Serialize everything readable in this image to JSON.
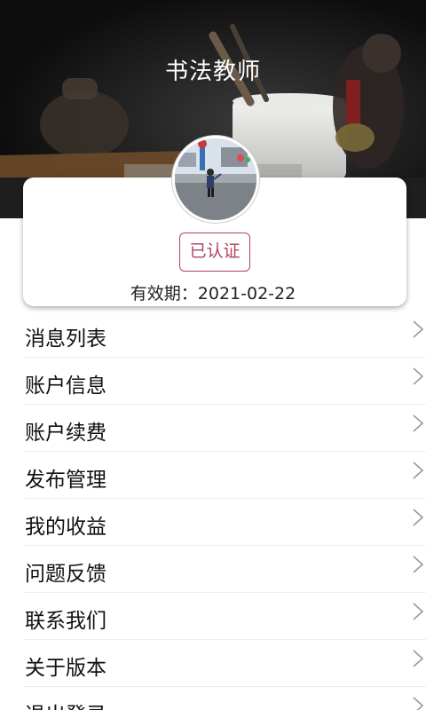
{
  "header": {
    "title": "书法教师"
  },
  "profile": {
    "badge_label": "已认证",
    "expiry_text": "有效期：2021-02-22"
  },
  "menu": {
    "items": [
      {
        "label": "消息列表"
      },
      {
        "label": "账户信息"
      },
      {
        "label": "账户续费"
      },
      {
        "label": "发布管理"
      },
      {
        "label": "我的收益"
      },
      {
        "label": "问题反馈"
      },
      {
        "label": "联系我们"
      },
      {
        "label": "关于版本"
      },
      {
        "label": "退出登录"
      }
    ]
  },
  "colors": {
    "badge": "#b0425f",
    "header_bg": "#121212"
  }
}
